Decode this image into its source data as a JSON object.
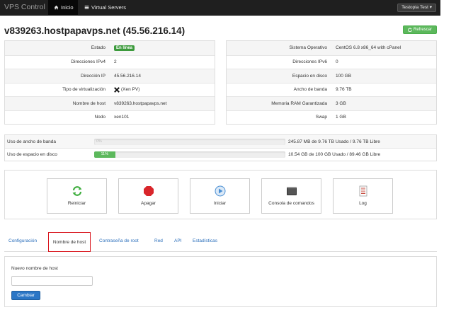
{
  "navbar": {
    "brand": "VPS Control",
    "home_label": "Inicio",
    "servers_label": "Virtual Servers",
    "user_menu": "Testopia Test"
  },
  "page": {
    "title": "v839263.hostpapavps.net (45.56.216.14)",
    "refresh_label": "Refrescar"
  },
  "info_left": [
    {
      "label": "Estado",
      "value": "En línea",
      "badge": true
    },
    {
      "label": "Direcciones IPv4",
      "value": "2"
    },
    {
      "label": "Dirección IP",
      "value": "45.56.216.14"
    },
    {
      "label": "Tipo de virtualización",
      "value": "(Xen PV)",
      "icon": "xen-icon"
    },
    {
      "label": "Nombre de host",
      "value": "v839263.hostpapavps.net"
    },
    {
      "label": "Nodo",
      "value": "xen101"
    }
  ],
  "info_right": [
    {
      "label": "Sistema Operativo",
      "value": "CentOS 6.8 x86_64 with cPanel"
    },
    {
      "label": "Direcciones IPv6",
      "value": "0"
    },
    {
      "label": "Espacio en disco",
      "value": "100 GB"
    },
    {
      "label": "Ancho de banda",
      "value": "9.76 TB"
    },
    {
      "label": "Memoria RAM Garantizada",
      "value": "3 GB"
    },
    {
      "label": "Swap",
      "value": "1 GB"
    }
  ],
  "usage": [
    {
      "label": "Uso de ancho de banda",
      "percent": 0,
      "bar_text": "0%",
      "value": "245.87 MB de 9.76 TB Usado / 9.76 TB Libre"
    },
    {
      "label": "Uso de espacio en disco",
      "percent": 11,
      "bar_text": "11%",
      "value": "10.54 GB de 100 GB Usado / 89.46 GB Libre"
    }
  ],
  "actions": [
    {
      "label": "Reiniciar",
      "icon": "restart-icon",
      "color": "#3fae3f"
    },
    {
      "label": "Apagar",
      "icon": "stop-icon",
      "color": "#d9262b"
    },
    {
      "label": "Iniciar",
      "icon": "play-icon",
      "color": "#4a8fd4"
    },
    {
      "label": "Consola de comandos",
      "icon": "console-icon",
      "color": "#333333"
    },
    {
      "label": "Log",
      "icon": "log-icon",
      "color": "#c0392b"
    }
  ],
  "tabs": [
    {
      "label": "Configuración"
    },
    {
      "label": "Nombre de host",
      "active": true
    },
    {
      "label": "Contraseña de root"
    },
    {
      "label": "Red"
    },
    {
      "label": "API"
    },
    {
      "label": "Estadísticas"
    }
  ],
  "form": {
    "label": "Nuevo nombre de host",
    "input_value": "",
    "submit_label": "Cambiar"
  }
}
